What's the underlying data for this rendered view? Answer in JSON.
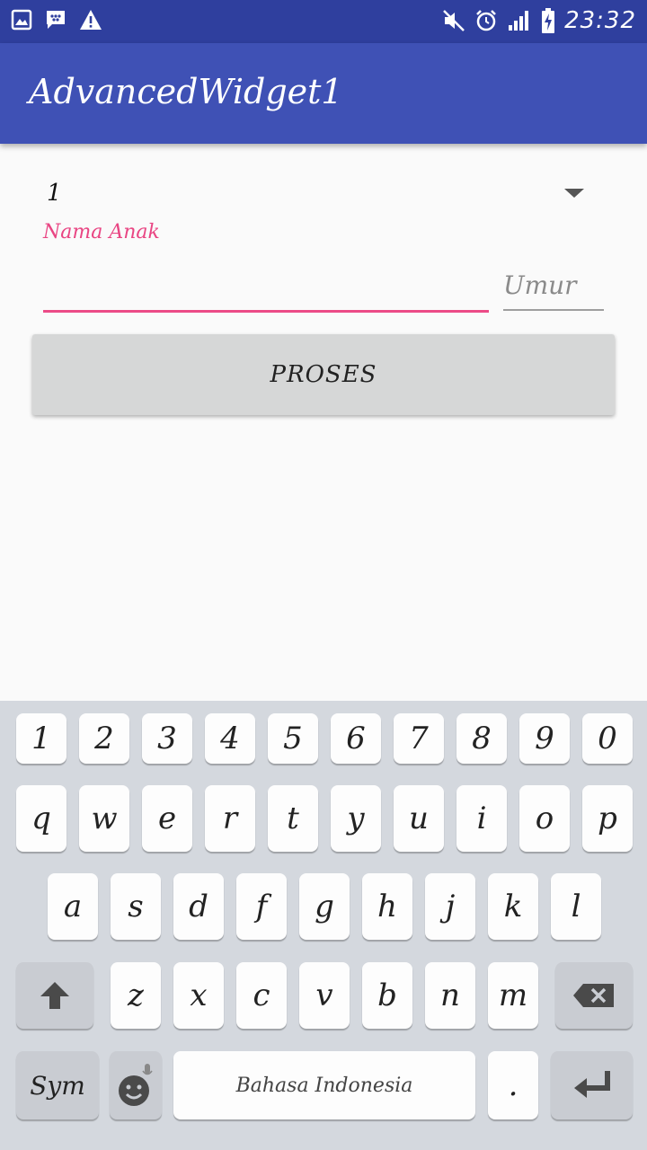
{
  "status_bar": {
    "time": "23:32"
  },
  "app_bar": {
    "title": "AdvancedWidget1"
  },
  "form": {
    "spinner_value": "1",
    "nama_label": "Nama Anak",
    "nama_value": "",
    "umur_placeholder": "Umur",
    "proses_label": "PROSES"
  },
  "keyboard": {
    "row1": [
      "1",
      "2",
      "3",
      "4",
      "5",
      "6",
      "7",
      "8",
      "9",
      "0"
    ],
    "row2": [
      "q",
      "w",
      "e",
      "r",
      "t",
      "y",
      "u",
      "i",
      "o",
      "p"
    ],
    "row3": [
      "a",
      "s",
      "d",
      "f",
      "g",
      "h",
      "j",
      "k",
      "l"
    ],
    "row4": [
      "z",
      "x",
      "c",
      "v",
      "b",
      "n",
      "m"
    ],
    "sym_label": "Sym",
    "space_label": "Bahasa Indonesia",
    "period_label": "."
  }
}
